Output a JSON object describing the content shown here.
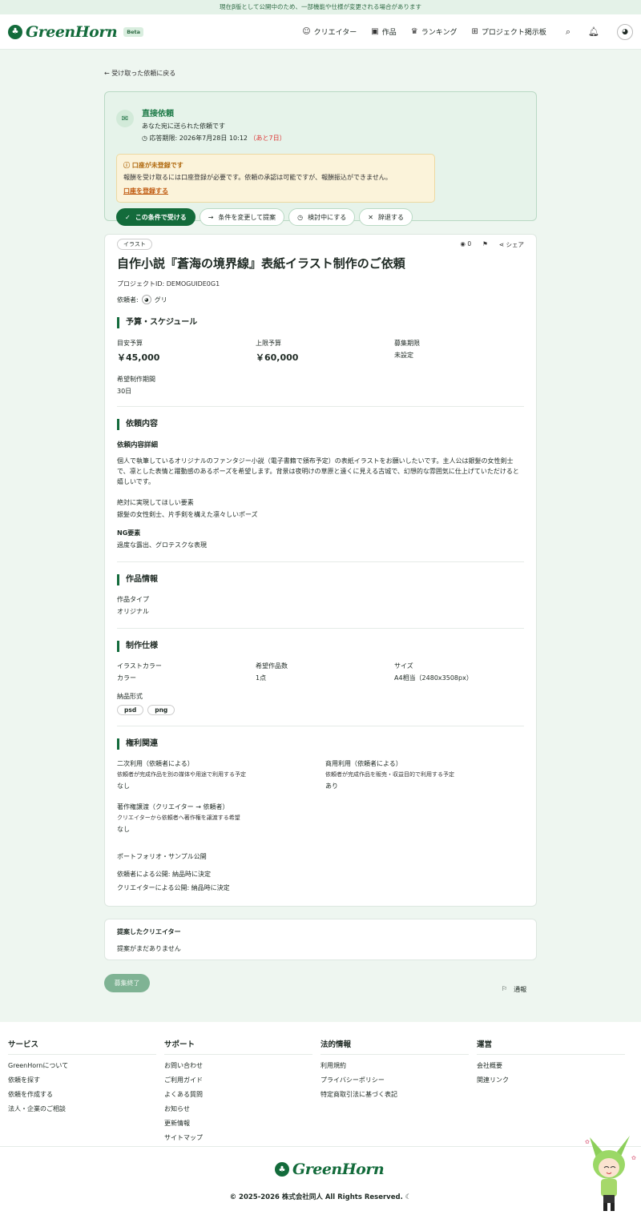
{
  "banner": "現在β版として公開中のため、一部機能や仕様が変更される場合があります",
  "brand": {
    "name": "GreenHorn",
    "badge": "Beta"
  },
  "nav": {
    "creators": "クリエイター",
    "works": "作品",
    "ranking": "ランキング",
    "board": "プロジェクト掲示板"
  },
  "back_link": "← 受け取った依頼に戻る",
  "request": {
    "type": "直接依頼",
    "subtitle": "あなた宛に送られた依頼です",
    "deadline": "応答期限: 2026年7月28日 10:12",
    "remaining": "（あと7日）",
    "warning_title": "口座が未登録です",
    "warning_text": "報酬を受け取るには口座登録が必要です。依頼の承認は可能ですが、報酬振込ができません。",
    "warning_link": "口座を登録する",
    "actions": {
      "accept": "この条件で受ける",
      "propose": "条件を変更して提案",
      "consider": "検討中にする",
      "decline": "辞退する"
    }
  },
  "project": {
    "category": "イラスト",
    "views": "0",
    "share": "シェア",
    "title": "自作小説『蒼海の境界線』表紙イラスト制作のご依頼",
    "project_id": "プロジェクトID: DEMOGUIDE0G1",
    "requester_label": "依頼者:",
    "requester_name": "グリ",
    "budget": {
      "heading": "予算・スケジュール",
      "target_label": "目安予算",
      "target_value": "￥45,000",
      "max_label": "上限予算",
      "max_value": "￥60,000",
      "period_label": "募集期限",
      "period_value": "未設定",
      "duration_label": "希望制作期間",
      "duration_value": "30日"
    },
    "content": {
      "heading": "依頼内容",
      "detail_label": "依頼内容詳細",
      "detail_text": "個人で執筆しているオリジナルのファンタジー小説（電子書籍で頒布予定）の表紙イラストをお願いしたいです。主人公は銀髪の女性剣士で、凛とした表情と躍動感のあるポーズを希望します。背景は夜明けの草原と遠くに見える古城で、幻想的な雰囲気に仕上げていただけると嬉しいです。",
      "must_label": "絶対に実現してほしい要素",
      "must_text": "銀髪の女性剣士、片手剣を構えた凛々しいポーズ",
      "ng_label": "NG要素",
      "ng_text": "過度な露出、グロテスクな表現"
    },
    "work": {
      "heading": "作品情報",
      "type_label": "作品タイプ",
      "type_value": "オリジナル"
    },
    "spec": {
      "heading": "制作仕様",
      "color_label": "イラストカラー",
      "color_value": "カラー",
      "count_label": "希望作品数",
      "count_value": "1点",
      "size_label": "サイズ",
      "size_value": "A4相当（2480x3508px）",
      "format_label": "納品形式",
      "formats": [
        "psd",
        "png"
      ]
    },
    "rights": {
      "heading": "権利関連",
      "secondary_label": "二次利用（依頼者による）",
      "secondary_desc": "依頼者が完成作品を別の媒体や用途で利用する予定",
      "secondary_value": "なし",
      "commercial_label": "商用利用（依頼者による）",
      "commercial_desc": "依頼者が完成作品を販売・収益目的で利用する予定",
      "commercial_value": "あり",
      "transfer_label": "著作権譲渡（クリエイター → 依頼者）",
      "transfer_desc": "クリエイターから依頼者へ著作権を譲渡する希望",
      "transfer_value": "なし",
      "portfolio_label": "ポートフォリオ・サンプル公開",
      "by_client": "依頼者による公開:  納品時に決定",
      "by_creator": "クリエイターによる公開:  納品時に決定"
    }
  },
  "proposals": {
    "heading": "提案したクリエイター",
    "empty": "提案がまだありません"
  },
  "closed_button": "募集終了",
  "report": "通報",
  "footer": {
    "columns": [
      {
        "heading": "サービス",
        "links": [
          "GreenHornについて",
          "依頼を探す",
          "依頼を作成する",
          "法人・企業のご相談"
        ]
      },
      {
        "heading": "サポート",
        "links": [
          "お問い合わせ",
          "ご利用ガイド",
          "よくある質問",
          "お知らせ",
          "更新情報",
          "サイトマップ"
        ]
      },
      {
        "heading": "法的情報",
        "links": [
          "利用規約",
          "プライバシーポリシー",
          "特定商取引法に基づく表記"
        ]
      },
      {
        "heading": "運営",
        "links": [
          "会社概要",
          "関連リンク"
        ]
      }
    ],
    "copyright": "© 2025-2026 株式会社同人 All Rights Reserved."
  },
  "colors": {
    "brand": "#136b3b",
    "warning": "#b06a10",
    "danger": "#d33333",
    "background": "#eef6f0"
  }
}
